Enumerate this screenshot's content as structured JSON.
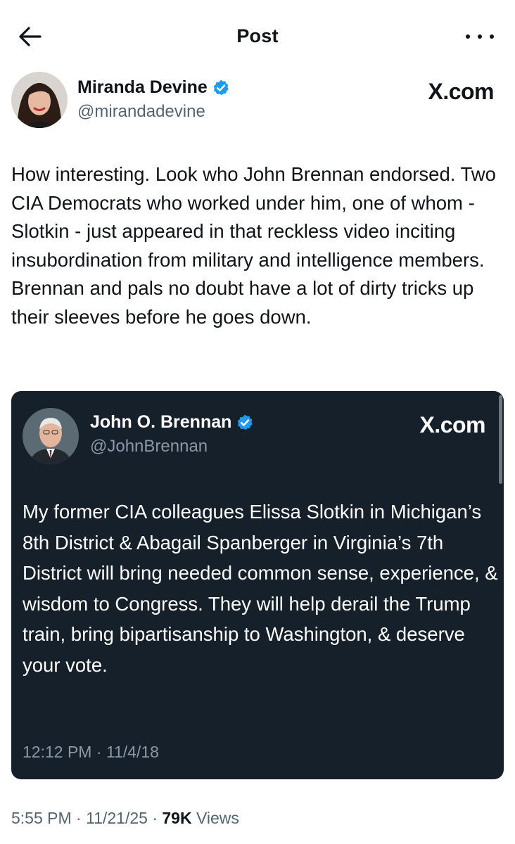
{
  "header": {
    "title": "Post"
  },
  "post": {
    "author_name": "Miranda Devine",
    "author_handle": "@mirandadevine",
    "brand": "X.com",
    "text_lines": [
      "How interesting. Look who John Brennan endorsed. Two CIA Democrats who worked under him, one of whom - Slotkin - just appeared in that reckless video inciting insubordination from military and intelligence members.",
      "Brennan and pals no doubt have a lot of dirty tricks up their sleeves before he goes down."
    ],
    "time": "5:55 PM",
    "date": "11/21/25",
    "views_count": "79K",
    "views_label": "Views"
  },
  "quoted": {
    "author_name": "John O. Brennan",
    "author_handle": "@JohnBrennan",
    "brand": "X.com",
    "text": "My former CIA colleagues Elissa Slotkin in Michigan’s 8th District & Abagail Spanberger in Virginia’s 7th District will bring needed common sense, experience, & wisdom to Congress. They will help derail the Trump train, bring bipartisanship to Washington, & deserve your vote.",
    "time": "12:12 PM",
    "date": "11/4/18"
  },
  "colors": {
    "verified": "#1d9bf0",
    "quote_bg": "#15202b",
    "muted": "#536471"
  }
}
